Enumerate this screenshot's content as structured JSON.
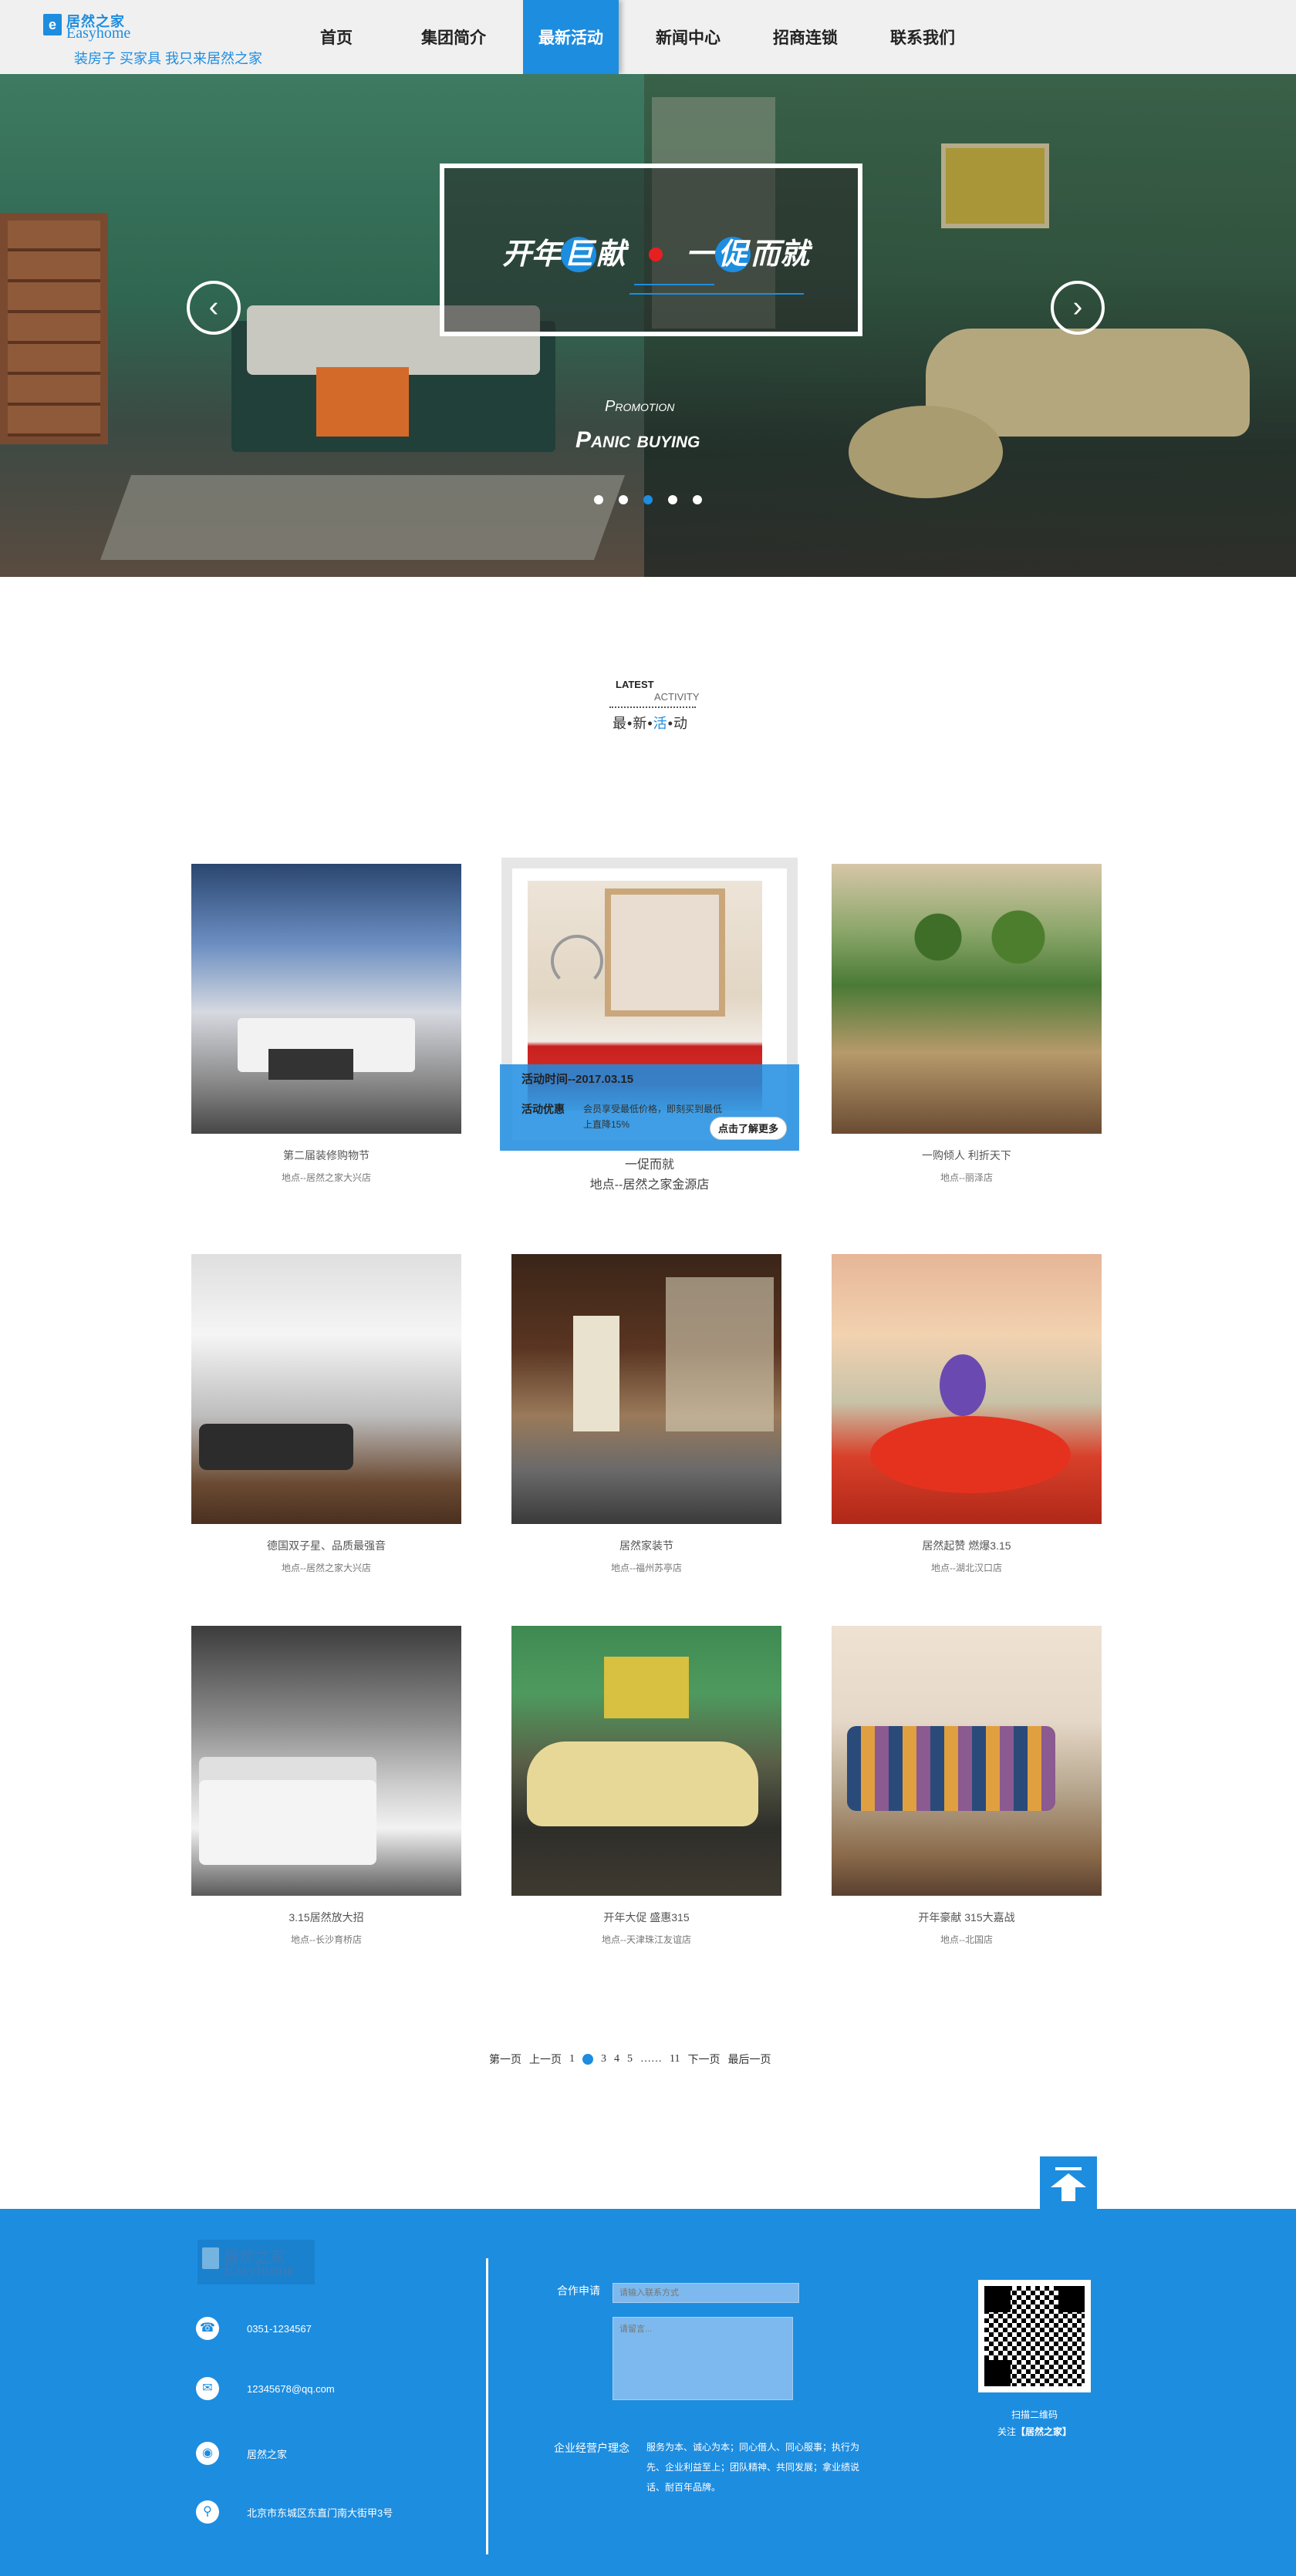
{
  "header": {
    "logo": {
      "mark": "e",
      "cn": "居然之家",
      "en": "Easyhome",
      "slogan": "装房子 买家具 我只来居然之家"
    },
    "nav": [
      {
        "label": "首页",
        "active": false
      },
      {
        "label": "集团简介",
        "active": false
      },
      {
        "label": "最新活动",
        "active": true
      },
      {
        "label": "新闻中心",
        "active": false
      },
      {
        "label": "招商连锁",
        "active": false
      },
      {
        "label": "联系我们",
        "active": false
      }
    ]
  },
  "banner": {
    "title_a": "开年",
    "title_b": "巨",
    "title_c": "献",
    "title_d": "一",
    "title_e": "促",
    "title_f": "而就",
    "sub": "Promotion",
    "main": "Panic buying",
    "prev_glyph": "‹",
    "next_glyph": "›",
    "dots_total": 5,
    "active_dot": 3
  },
  "section": {
    "latest": "LATEST",
    "activity": "ACTIVITY",
    "cn_1": "最",
    "cn_2": "新",
    "cn_3": "活",
    "cn_4": "动",
    "sep": "•"
  },
  "cards": [
    {
      "caption": "第二届装修购物节",
      "loc": "地点--居然之家大兴店"
    },
    {
      "caption": "一促而就",
      "loc": "地点--居然之家金源店"
    },
    {
      "caption": "一购倾人  利折天下",
      "loc": "地点--丽泽店"
    },
    {
      "caption": "德国双子星、品质最强音",
      "loc": "地点--居然之家大兴店"
    },
    {
      "caption": "居然家装节",
      "loc": "地点--福州苏亭店"
    },
    {
      "caption": "居然起赞 燃爆3.15",
      "loc": "地点--湖北汉口店"
    },
    {
      "caption": "3.15居然放大招",
      "loc": "地点--长沙育桥店"
    },
    {
      "caption": "开年大促  盛惠315",
      "loc": "地点--天津珠江友谊店"
    },
    {
      "caption": "开年豪献  315大嘉战",
      "loc": "地点--北国店"
    }
  ],
  "featured": {
    "time": "活动时间--2017.03.15",
    "label": "活动优惠",
    "desc": "会员享受最低价格，即刻买到最低上直降15%",
    "button": "点击了解更多"
  },
  "pager": {
    "first": "第一页",
    "prev": "上一页",
    "p1": "1",
    "p3": "3",
    "p4": "4",
    "p5": "5",
    "ellipsis": "……",
    "p11": "11",
    "next": "下一页",
    "last": "最后一页"
  },
  "footer": {
    "logo_cn": "居然之家",
    "logo_en": "Easyhome",
    "phone": "0351-1234567",
    "email": "12345678@qq.com",
    "weibo": "居然之家",
    "address": "北京市东城区东直门南大街甲3号",
    "icons": {
      "phone": "phone-icon",
      "email": "mail-icon",
      "weibo": "weibo-icon",
      "address": "location-icon"
    },
    "coop_label": "合作申请",
    "input_placeholder": "请输入联系方式",
    "textarea_placeholder": "请留言...",
    "idea_label": "企业经营户理念",
    "idea_text": "服务为本、诚心为本；同心借人、同心服事；执行为先、企业利益至上；团队精神、共同发展；拿业绩说话、耐百年品牌。",
    "qr_cap1": "扫描二维码",
    "qr_cap2_a": "关注",
    "qr_cap2_b": "【居然之家】"
  },
  "colors": {
    "brand": "#1d8de0",
    "accent_red": "#e62020"
  }
}
